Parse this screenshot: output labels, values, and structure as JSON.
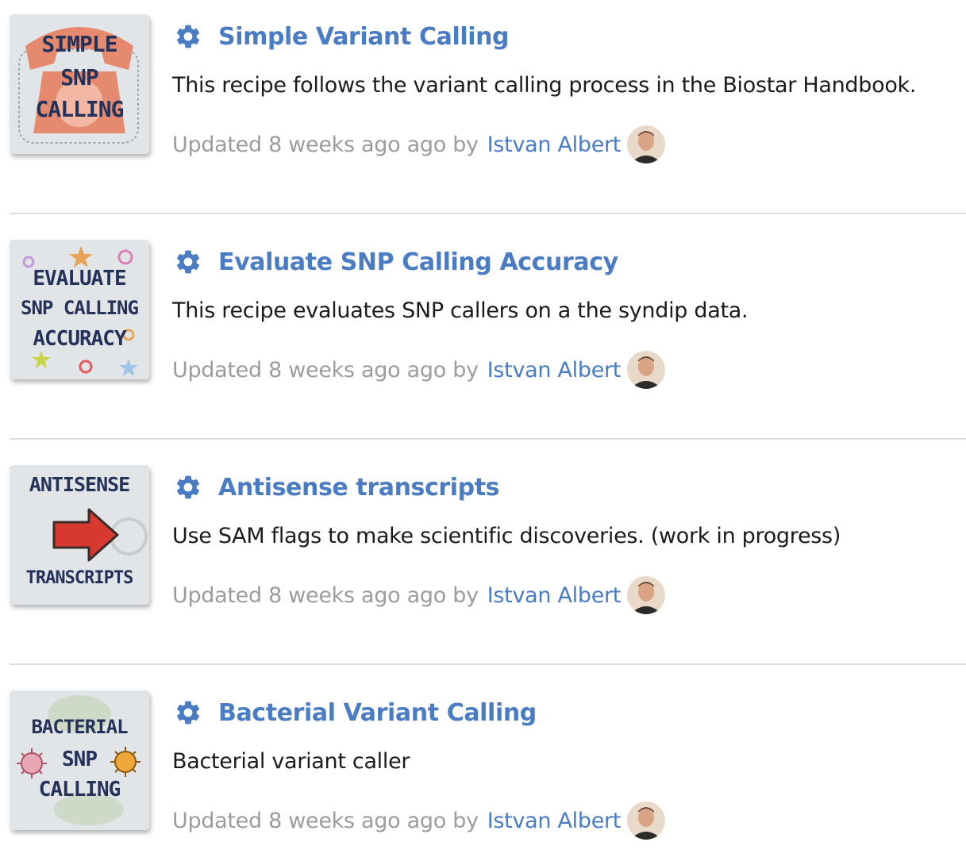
{
  "recipes": [
    {
      "title": "Simple Variant Calling",
      "description": "This recipe follows the variant calling process in the Biostar Handbook.",
      "updated": "Updated 8 weeks ago ago by",
      "author": "Istvan Albert",
      "thumbnail_lines": [
        "SIMPLE",
        "SNP",
        "CALLING"
      ],
      "thumbnail_icon": "telephone-image"
    },
    {
      "title": "Evaluate SNP Calling Accuracy",
      "description": "This recipe evaluates SNP callers on a the syndip data.",
      "updated": "Updated 8 weeks ago ago by",
      "author": "Istvan Albert",
      "thumbnail_lines": [
        "EVALUATE",
        "SNP CALLING",
        "ACCURACY"
      ],
      "thumbnail_icon": "stars-swirls-image"
    },
    {
      "title": "Antisense transcripts",
      "description": "Use SAM flags to make scientific discoveries. (work in progress)",
      "updated": "Updated 8 weeks ago ago by",
      "author": "Istvan Albert",
      "thumbnail_lines": [
        "ANTISENSE",
        "TRANSCRIPTS"
      ],
      "thumbnail_icon": "red-arrow-image"
    },
    {
      "title": "Bacterial Variant Calling",
      "description": "Bacterial variant caller",
      "updated": "Updated 8 weeks ago ago by",
      "author": "Istvan Albert",
      "thumbnail_lines": [
        "BACTERIAL",
        "SNP",
        "CALLING"
      ],
      "thumbnail_icon": "bacteria-image"
    }
  ],
  "colors": {
    "link": "#4a7cc4",
    "muted": "#9c9c9c",
    "text": "#1b1b1b",
    "divider": "#dcdcdc",
    "thumbnail_text": "#243259"
  },
  "icons": {
    "recipe_icon": "gear-icon",
    "author_avatar": "avatar"
  }
}
